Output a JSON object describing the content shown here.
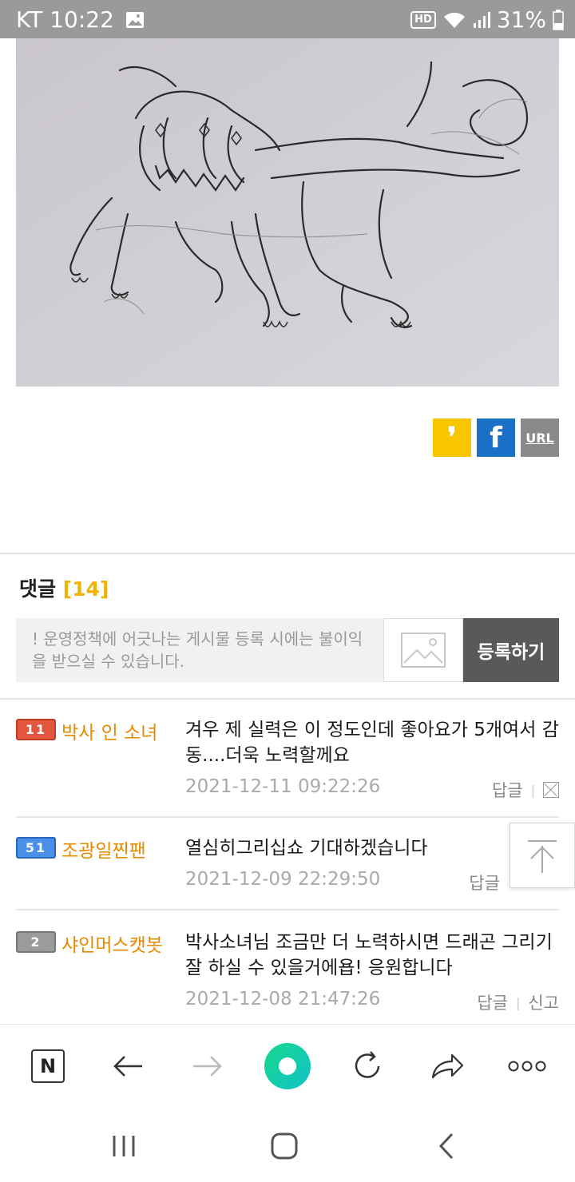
{
  "status_bar": {
    "carrier_time": "KT 10:22",
    "hd": "HD",
    "battery": "31%"
  },
  "share": {
    "url_label": "URL"
  },
  "comments_section": {
    "title": "댓글",
    "count": "[14]",
    "input_placeholder": "! 운영정책에 어긋나는 게시물 등록 시에는 불이익을 받으실 수 있습니다.",
    "submit_label": "등록하기"
  },
  "comments": [
    {
      "level": "11",
      "nickname": "박사 인 소녀",
      "text": "겨우 제 실력은 이 정도인데 좋아요가 5개여서 감동....더욱 노력할께요",
      "date": "2021-12-11 09:22:26",
      "reply": "답글"
    },
    {
      "level": "51",
      "nickname": "조광일찐팬",
      "text": "열심히그리십쇼 기대하겠습니다",
      "date": "2021-12-09 22:29:50",
      "reply": "답글"
    },
    {
      "level": "2",
      "nickname": "샤인머스캣봇",
      "text": "박사소녀님 조금만 더 노력하시면 드래곤 그리기 잘 하실 수 있을거에욥! 응원합니다",
      "date": "2021-12-08 21:47:26",
      "reply": "답글",
      "report": "신고"
    }
  ],
  "browser_bar": {
    "home_letter": "N"
  },
  "colors": {
    "accent_count": "#f0b400",
    "nickname": "#e68a00",
    "submit_bg": "#595959",
    "status_bar_bg": "#9a9a9a"
  }
}
